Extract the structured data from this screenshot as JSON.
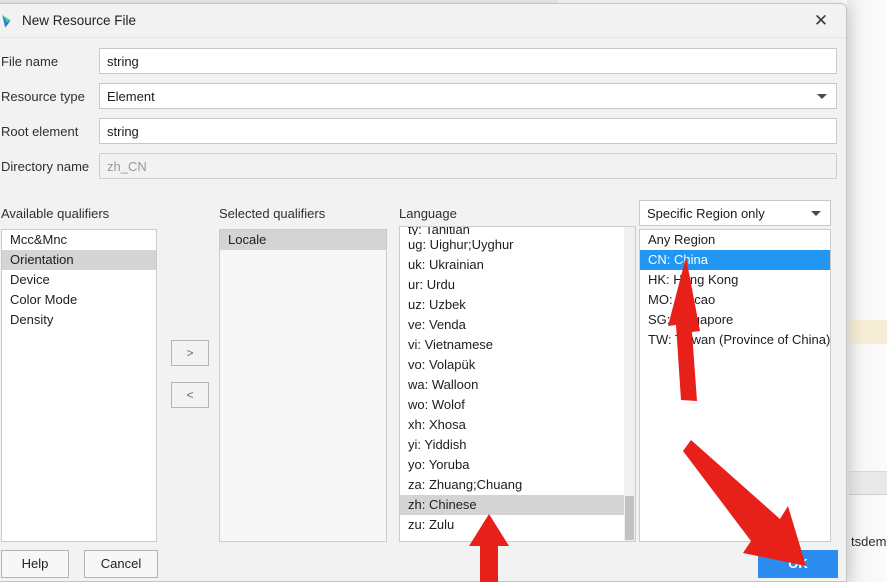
{
  "dialog": {
    "title": "New Resource File",
    "icon": "android-studio-icon",
    "close_icon": "close-icon"
  },
  "form": {
    "fields": [
      {
        "label": "File name",
        "value": "string",
        "type": "text",
        "placeholder": ""
      },
      {
        "label": "Resource type",
        "value": "Element",
        "type": "combo",
        "placeholder": ""
      },
      {
        "label": "Root element",
        "value": "string",
        "type": "text",
        "placeholder": ""
      },
      {
        "label": "Directory name",
        "value": "zh_CN",
        "type": "text-disabled",
        "placeholder": "zh_CN"
      }
    ]
  },
  "columns": {
    "available_qualifiers": "Available qualifiers",
    "selected_qualifiers": "Selected qualifiers",
    "language": "Language"
  },
  "available_qualifiers": {
    "items": [
      "Mcc&Mnc",
      "Orientation",
      "Device",
      "Color Mode",
      "Density"
    ],
    "selected": "Orientation"
  },
  "selected_qualifiers": {
    "items": [
      "Locale"
    ],
    "selected": "Locale"
  },
  "transfer": {
    "add_label": ">",
    "remove_label": "<"
  },
  "language_list": {
    "clipped_top_item": "ty: Tahitian",
    "items": [
      "ug: Uighur;Uyghur",
      "uk: Ukrainian",
      "ur: Urdu",
      "uz: Uzbek",
      "ve: Venda",
      "vi: Vietnamese",
      "vo: Volapük",
      "wa: Walloon",
      "wo: Wolof",
      "xh: Xhosa",
      "yi: Yiddish",
      "yo: Yoruba",
      "za: Zhuang;Chuang",
      "zh: Chinese",
      "zu: Zulu"
    ],
    "selected": "zh: Chinese"
  },
  "region_mode": {
    "value": "Specific Region only",
    "chevron_icon": "chevron-down-icon"
  },
  "region_list": {
    "items": [
      "Any Region",
      "CN: China",
      "HK: Hong Kong",
      "MO: Macao",
      "SG: Singapore",
      "TW: Taiwan (Province of China)"
    ],
    "selected": "CN: China"
  },
  "buttons": {
    "help": "Help",
    "cancel": "Cancel",
    "ok": "OK"
  },
  "background": {
    "edge_label": "tsdemo"
  },
  "colors": {
    "selection_blue": "#2196f3",
    "primary_button": "#2d8cf0",
    "selection_gray": "#d4d4d4",
    "annotation_red": "#e8201a",
    "dialog_bg": "#f2f2f2"
  },
  "annotations": {
    "arrow_to_region": "red-arrow-up",
    "arrow_to_ok": "red-arrow-down-right",
    "arrow_to_language": "red-arrow-up-small"
  }
}
